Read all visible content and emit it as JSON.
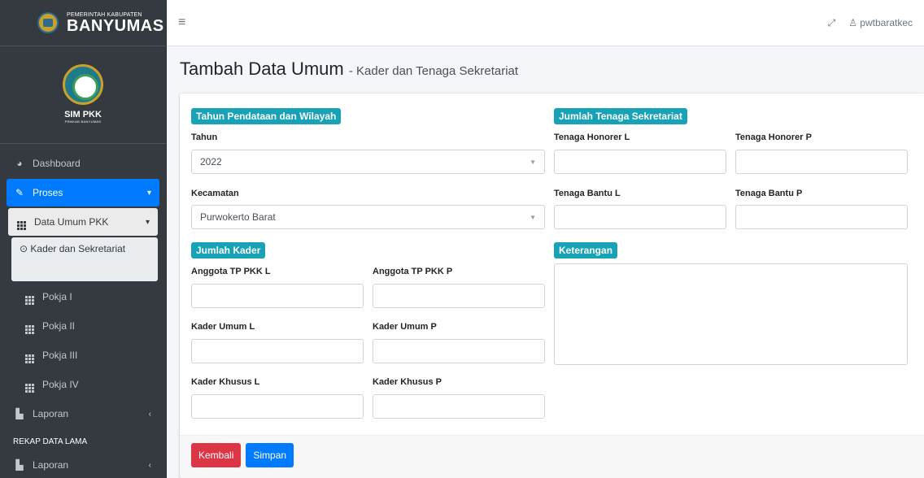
{
  "brand": {
    "small": "PEMERINTAH KABUPATEN",
    "big": "BANYUMAS"
  },
  "app": {
    "title": "SIM PKK",
    "subtitle": "PEMKAB BANYUMAS"
  },
  "sidebar": {
    "items": [
      {
        "label": "Dashboard",
        "icon": "dashboard-icon"
      },
      {
        "label": "Proses",
        "icon": "edit-icon"
      },
      {
        "label": "Data Umum PKK",
        "icon": "grid-icon"
      },
      {
        "label": "Kader dan Sekretariat",
        "icon": "radio-circle-icon"
      },
      {
        "label": "Pokja I",
        "icon": "grid-icon"
      },
      {
        "label": "Pokja II",
        "icon": "grid-icon"
      },
      {
        "label": "Pokja III",
        "icon": "grid-icon"
      },
      {
        "label": "Pokja IV",
        "icon": "grid-icon"
      },
      {
        "label": "Laporan",
        "icon": "file-icon"
      }
    ],
    "header": "REKAP DATA LAMA",
    "lama_item": {
      "label": "Laporan",
      "icon": "file-icon"
    }
  },
  "topbar": {
    "user": "pwtbaratkec"
  },
  "page": {
    "title": "Tambah Data Umum",
    "subtitle": "- Kader dan Tenaga Sekretariat"
  },
  "form": {
    "section_wilayah": "Tahun Pendataan dan Wilayah",
    "tahun_label": "Tahun",
    "tahun_value": "2022",
    "kecamatan_label": "Kecamatan",
    "kecamatan_value": "Purwokerto Barat",
    "section_kader": "Jumlah Kader",
    "anggota_l": "Anggota TP PKK L",
    "anggota_p": "Anggota TP PKK P",
    "umum_l": "Kader Umum L",
    "umum_p": "Kader Umum P",
    "khusus_l": "Kader Khusus L",
    "khusus_p": "Kader Khusus P",
    "section_sekretariat": "Jumlah Tenaga Sekretariat",
    "honorer_l": "Tenaga Honorer L",
    "honorer_p": "Tenaga Honorer P",
    "bantu_l": "Tenaga Bantu L",
    "bantu_p": "Tenaga Bantu P",
    "section_keterangan": "Keterangan"
  },
  "buttons": {
    "kembali": "Kembali",
    "simpan": "Simpan"
  },
  "colors": {
    "primary": "#007bff",
    "info": "#17a2b8",
    "danger": "#dc3545",
    "sidebar": "#343a40"
  }
}
